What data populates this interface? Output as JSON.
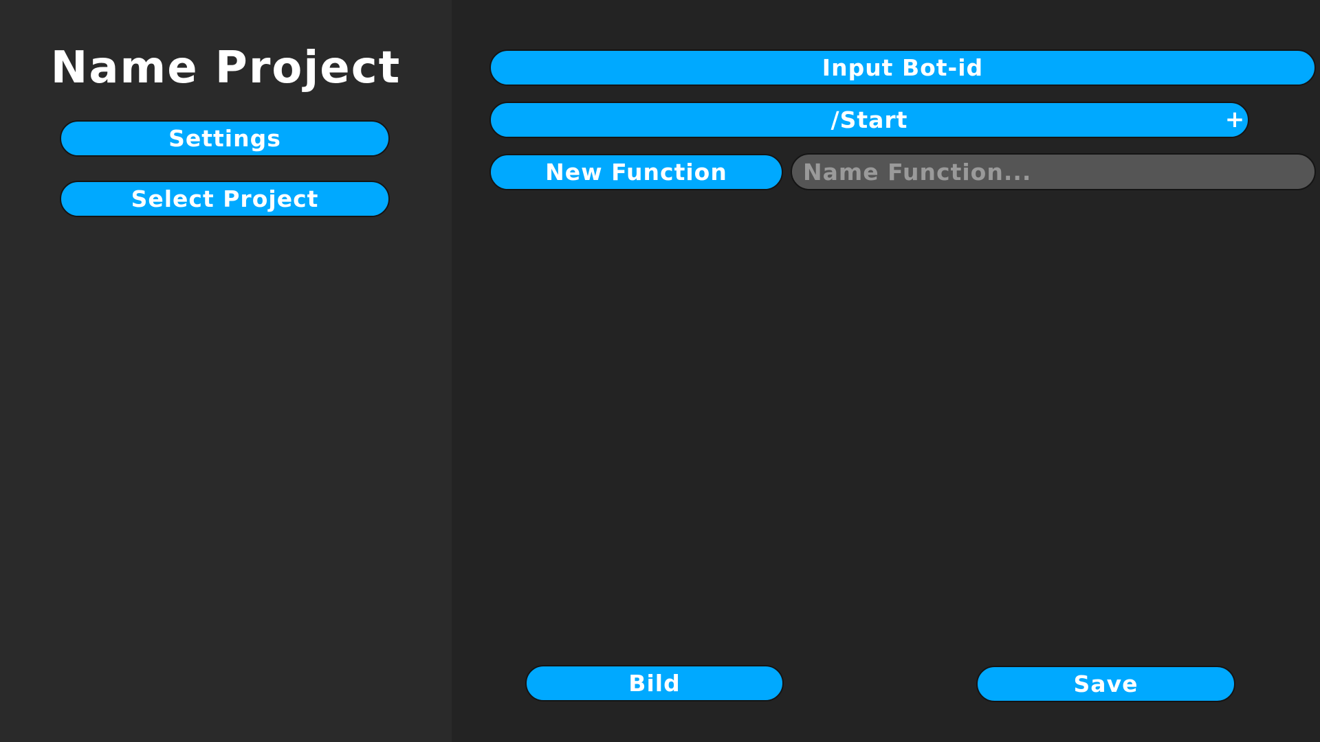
{
  "sidebar": {
    "project_title": "Name Project",
    "settings_label": "Settings",
    "select_project_label": "Select Project"
  },
  "main": {
    "bot_id_label": "Input Bot-id",
    "commands": [
      {
        "label": "/Start"
      }
    ],
    "add_label": "+",
    "new_function_label": "New Function",
    "function_name_placeholder": "Name Function...",
    "build_label": "Bild",
    "save_label": "Save"
  },
  "colors": {
    "accent": "#00a9ff",
    "sidebar_bg": "#2a2a2a",
    "main_bg": "#232323",
    "input_bg": "#555555",
    "text": "#ffffff",
    "placeholder_text": "#9a9a9a"
  }
}
